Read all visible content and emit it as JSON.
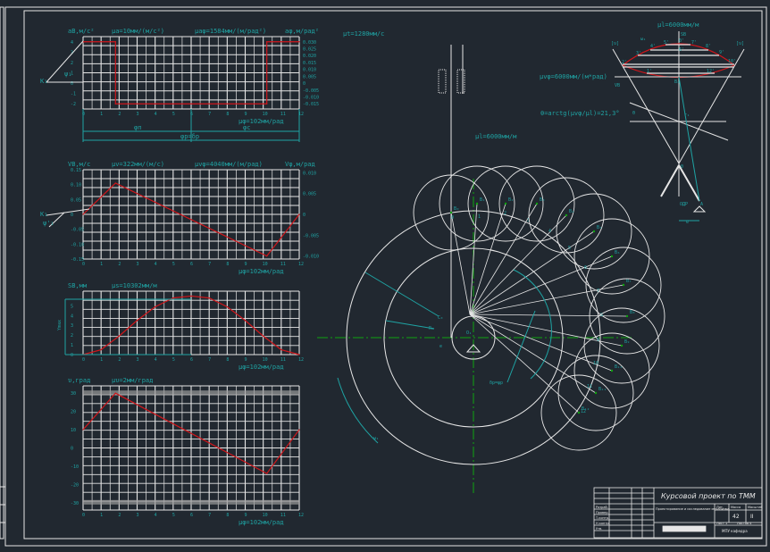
{
  "colors": {
    "background": "#212830",
    "lines": "#e6e6e6",
    "annotation": "#1fa3a3",
    "curve": "#d0161b",
    "axis": "#0fa30f"
  },
  "chart_data": [
    {
      "type": "line",
      "ylabel": "aB,м/с²",
      "y2label": "aφ,м/рад²",
      "scale_y": "μa=10мм/(м/с²)",
      "scale_y2": "μaφ=1584мм/(м/рад²)",
      "scale_x": "μφ=102мм/рад",
      "xlim": [
        0,
        12
      ],
      "ylim": [
        -2.5,
        4.5
      ],
      "x_ticks": [
        "0",
        "1",
        "2",
        "3",
        "4",
        "5",
        "6",
        "7",
        "8",
        "9",
        "10",
        "11",
        "12"
      ],
      "y_ticks": [
        "4",
        "3",
        "2",
        "1",
        "0",
        "-1",
        "-2"
      ],
      "y2_ticks": [
        "0.030",
        "0.025",
        "0.020",
        "0.015",
        "0.010",
        "0.005",
        "0",
        "-0.005",
        "-0.010",
        "-0.015"
      ],
      "series": [
        {
          "x": [
            0,
            1.8,
            1.8,
            10.2,
            10.2,
            12
          ],
          "y": [
            4,
            4,
            -2,
            -2,
            4,
            4
          ]
        }
      ],
      "phase_labels": {
        "phi_p": "φп",
        "phi_s": "φс",
        "phi_total": "φр=δр"
      },
      "k_label": "K₁",
      "psi_label": "ψ₁"
    },
    {
      "type": "line",
      "ylabel": "VB,м/с",
      "y2label": "Vφ,м/рад",
      "scale_y": "μv=322мм/(м/с)",
      "scale_y2": "μvφ=4040мм/(м/рад)",
      "scale_x": "μφ=102мм/рад",
      "xlim": [
        0,
        12
      ],
      "ylim": [
        -0.15,
        0.15
      ],
      "x_ticks": [
        "0",
        "1",
        "2",
        "3",
        "4",
        "5",
        "6",
        "7",
        "8",
        "9",
        "10",
        "11",
        "12"
      ],
      "y_ticks": [
        "0.15",
        "0.10",
        "0.05",
        "0",
        "-0.05",
        "-0.10",
        "-0.15"
      ],
      "y2_ticks": [
        "0.010",
        "0.005",
        "0",
        "-0.005",
        "-0.010"
      ],
      "series": [
        {
          "x": [
            0,
            1.8,
            10.2,
            12
          ],
          "y": [
            0,
            0.105,
            -0.14,
            0
          ]
        }
      ],
      "k_label": "K₁",
      "psi_label": "ψ'₁"
    },
    {
      "type": "line",
      "ylabel": "SB,мм",
      "scale_y": "μs=10302мм/м",
      "scale_x": "μφ=102мм/рад",
      "ymax_label": "Ymax",
      "xlim": [
        0,
        12
      ],
      "ylim": [
        0,
        6.5
      ],
      "x_ticks": [
        "0",
        "1",
        "2",
        "3",
        "4",
        "5",
        "6",
        "7",
        "8",
        "9",
        "10",
        "11",
        "12"
      ],
      "y_ticks": [
        "5",
        "4",
        "3",
        "2",
        "1",
        "0"
      ],
      "series": [
        {
          "x": [
            0,
            1,
            2,
            3,
            4,
            5,
            6,
            7,
            8,
            9,
            10,
            11,
            12
          ],
          "y": [
            0,
            0.5,
            1.9,
            3.5,
            4.9,
            5.8,
            6,
            5.8,
            4.9,
            3.5,
            1.9,
            0.5,
            0
          ]
        }
      ]
    },
    {
      "type": "line",
      "ylabel": "υ,град",
      "scale_y": "μυ=2мм/град",
      "scale_x": "μφ=102мм/рад",
      "xlim": [
        0,
        12
      ],
      "ylim": [
        -34,
        34
      ],
      "x_ticks": [
        "0",
        "1",
        "2",
        "3",
        "4",
        "5",
        "6",
        "7",
        "8",
        "9",
        "10",
        "11",
        "12"
      ],
      "y_ticks": [
        "30",
        "20",
        "10",
        "0",
        "-10",
        "-20",
        "-30"
      ],
      "limit_band": [
        -30,
        30
      ],
      "series": [
        {
          "x": [
            0,
            1.8,
            10.2,
            12
          ],
          "y": [
            10,
            30,
            -14,
            10
          ]
        }
      ]
    }
  ],
  "labels": {
    "mu_t": "μt=1280мм/с",
    "mu_l_cam": "μl=6000мм/м",
    "mu_l_top": "μl=6000мм/м",
    "mu_vphi_top": "μvφ=6000мм/(м*рад)",
    "theta": "θ=arctg(μvφ/μl)=21,3°",
    "sb": "SB",
    "vb": "VB",
    "omega1": "ω₁",
    "omega_cam": "ω₁",
    "nu_left": "[υ]",
    "nu_right": "[υ]",
    "odr": "ОДР",
    "a": "A",
    "e": "e",
    "o": "0",
    "r1": "r₁",
    "theta_small": "θ",
    "o1": "O₁",
    "c0": "C₀",
    "r0": "R₀",
    "e_cam": "e",
    "delta": "δр=φр",
    "profile_points": [
      "0",
      "1",
      "2",
      "3",
      "4",
      "5",
      "6",
      "7",
      "8",
      "9",
      "10",
      "11",
      "12"
    ],
    "b_points": [
      "B₀",
      "B₁",
      "B₂",
      "B₃",
      "B₄",
      "B₅",
      "B₆",
      "B₇",
      "B₈",
      "B₉",
      "B₁₀",
      "B₁₁",
      "B₁₂"
    ],
    "top_points": [
      "0'",
      "1'",
      "2'",
      "3'",
      "4'",
      "5'",
      "6'",
      "7'",
      "8'",
      "9'",
      "10'",
      "12'",
      "B₀"
    ]
  },
  "title_block": {
    "title": "Курсовой проект по ТММ",
    "description": "Проектирование и исследование механизма",
    "sheet_col1": "Лит.",
    "sheet_col2": "Масса",
    "sheet_col3": "Масштаб",
    "mass": "42",
    "scale": "II",
    "sheet": "Лист 1",
    "sheets": "Листов 4",
    "org": "МПУ кафедра",
    "roles": [
      "Разраб.",
      "Провер.",
      "Т.контр.",
      "Н.контр.",
      "Утв."
    ]
  }
}
